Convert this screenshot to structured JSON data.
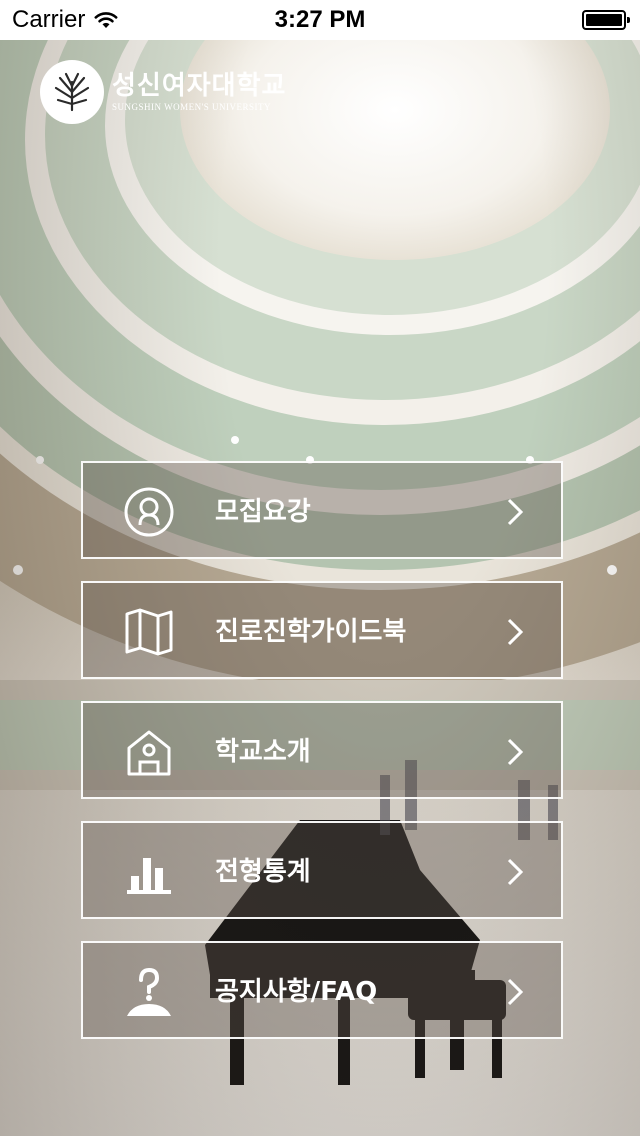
{
  "status_bar": {
    "carrier": "Carrier",
    "time": "3:27 PM"
  },
  "logo": {
    "name_kr": "성신여자대학교",
    "name_en": "SUNGSHIN WOMEN'S UNIVERSITY"
  },
  "menu": {
    "items": [
      {
        "label": "모집요강",
        "icon": "person-circle-icon"
      },
      {
        "label": "진로진학가이드북",
        "icon": "map-icon"
      },
      {
        "label": "학교소개",
        "icon": "house-person-icon"
      },
      {
        "label": "전형통계",
        "icon": "bar-chart-icon"
      },
      {
        "label": "공지사항/FAQ",
        "icon": "question-person-icon"
      }
    ]
  },
  "colors": {
    "button_border": "#ffffff",
    "button_fill": "rgba(95,85,75,0.38)",
    "text": "#ffffff"
  }
}
